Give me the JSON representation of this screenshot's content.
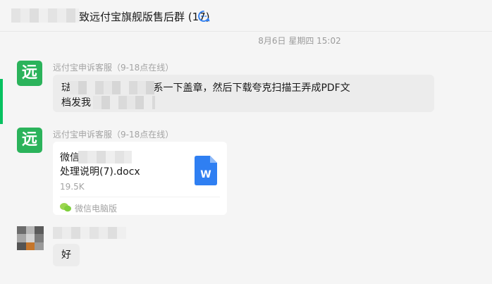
{
  "header": {
    "chat_title": "致远付宝旗舰版售后群 (17)",
    "title_icon": "group-chat-icon"
  },
  "timestamp": "8月6日 星期四 15:02",
  "messages": [
    {
      "sender": "远付宝申诉客服（9-18点在线）",
      "avatar_text": "远",
      "text_line1": "琺          公司，这个法人联系一下盖章，然后下载夸克扫描王弄成PDF文",
      "text_line2": "档发我"
    },
    {
      "sender": "远付宝申诉客服（9-18点在线）",
      "avatar_text": "远",
      "file": {
        "name_line1": "微信          风险排查及",
        "name_line2": "处理说明(7).docx",
        "size": "19.5K",
        "source": "微信电脑版",
        "file_icon": "word-file-icon",
        "file_icon_letter": "W"
      }
    },
    {
      "text": "好"
    }
  ],
  "colors": {
    "accent": "#07c160",
    "avatar_bg": "#2bb35b",
    "word_blue": "#2f7ff2"
  }
}
